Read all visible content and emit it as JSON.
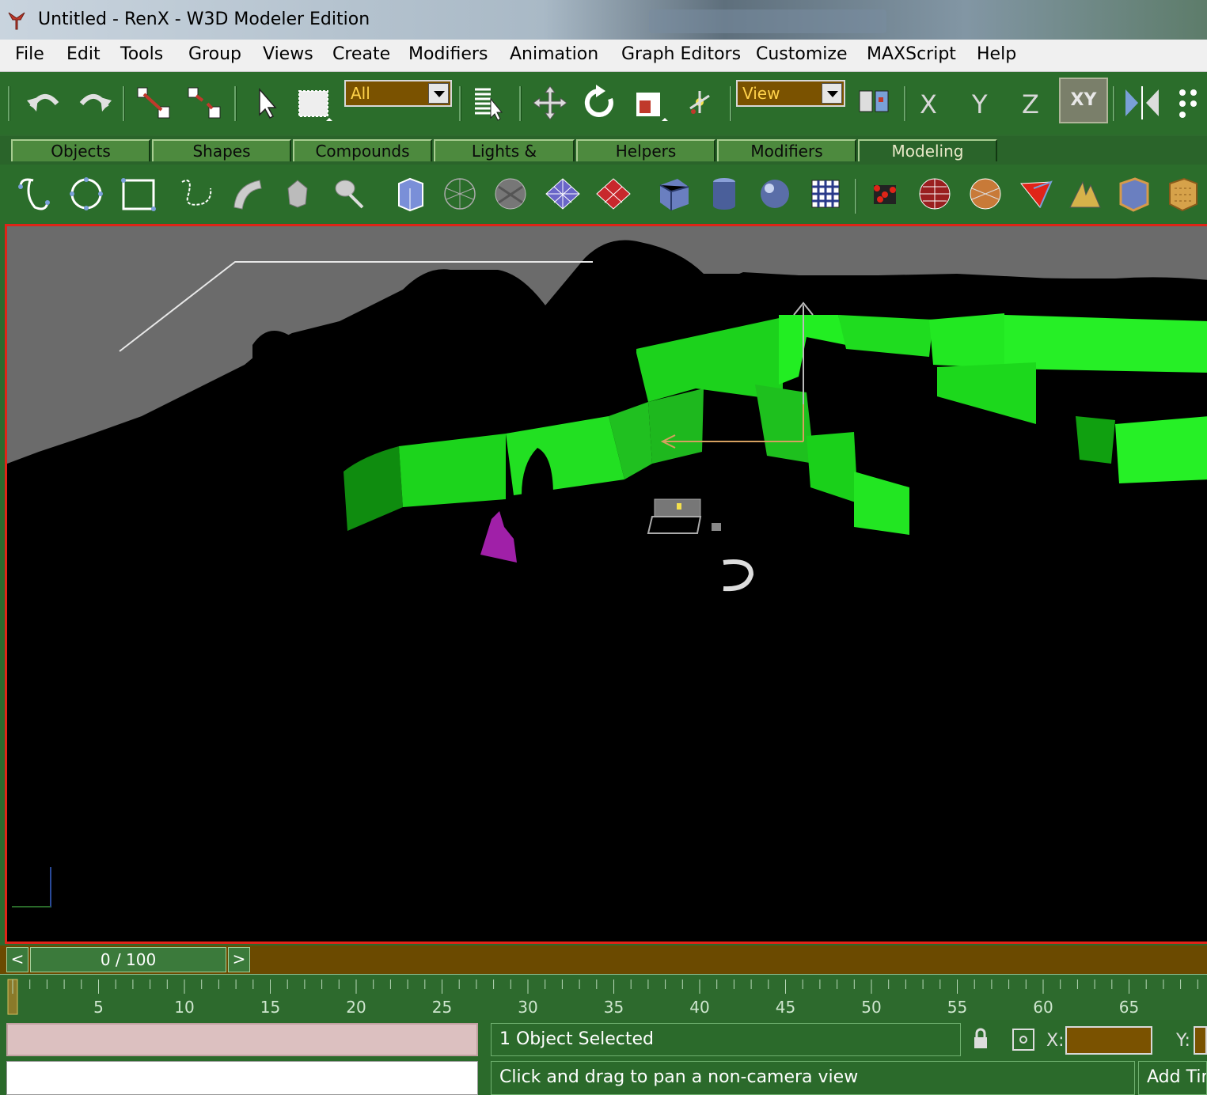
{
  "window": {
    "title": "Untitled - RenX - W3D Modeler Edition"
  },
  "menu": [
    "File",
    "Edit",
    "Tools",
    "Group",
    "Views",
    "Create",
    "Modifiers",
    "Animation",
    "Graph Editors",
    "Customize",
    "MAXScript",
    "Help"
  ],
  "toolbar": {
    "selection_filter": "All",
    "reference_coord": "View",
    "axis_x": "X",
    "axis_y": "Y",
    "axis_z": "Z",
    "axis_xy": "XY"
  },
  "tabs": [
    "Objects",
    "Shapes",
    "Compounds",
    "Lights & Cameras",
    "Helpers",
    "Modifiers",
    "Modeling"
  ],
  "active_tab": "Modeling",
  "timeline": {
    "prev": "<",
    "next": ">",
    "frame_display": "0 / 100",
    "ticks": [
      "5",
      "10",
      "15",
      "20",
      "25",
      "30",
      "35",
      "40",
      "45",
      "50",
      "55",
      "60",
      "65"
    ]
  },
  "status": {
    "selection": "1 Object Selected",
    "prompt": "Click and drag to pan a non-camera view",
    "x_label": "X:",
    "y_label": "Y:",
    "add_time_tag": "Add Tim"
  },
  "colors": {
    "panel_green": "#2b6d2b",
    "viewport_border": "#e02418",
    "wall_green": "#22dd22"
  }
}
